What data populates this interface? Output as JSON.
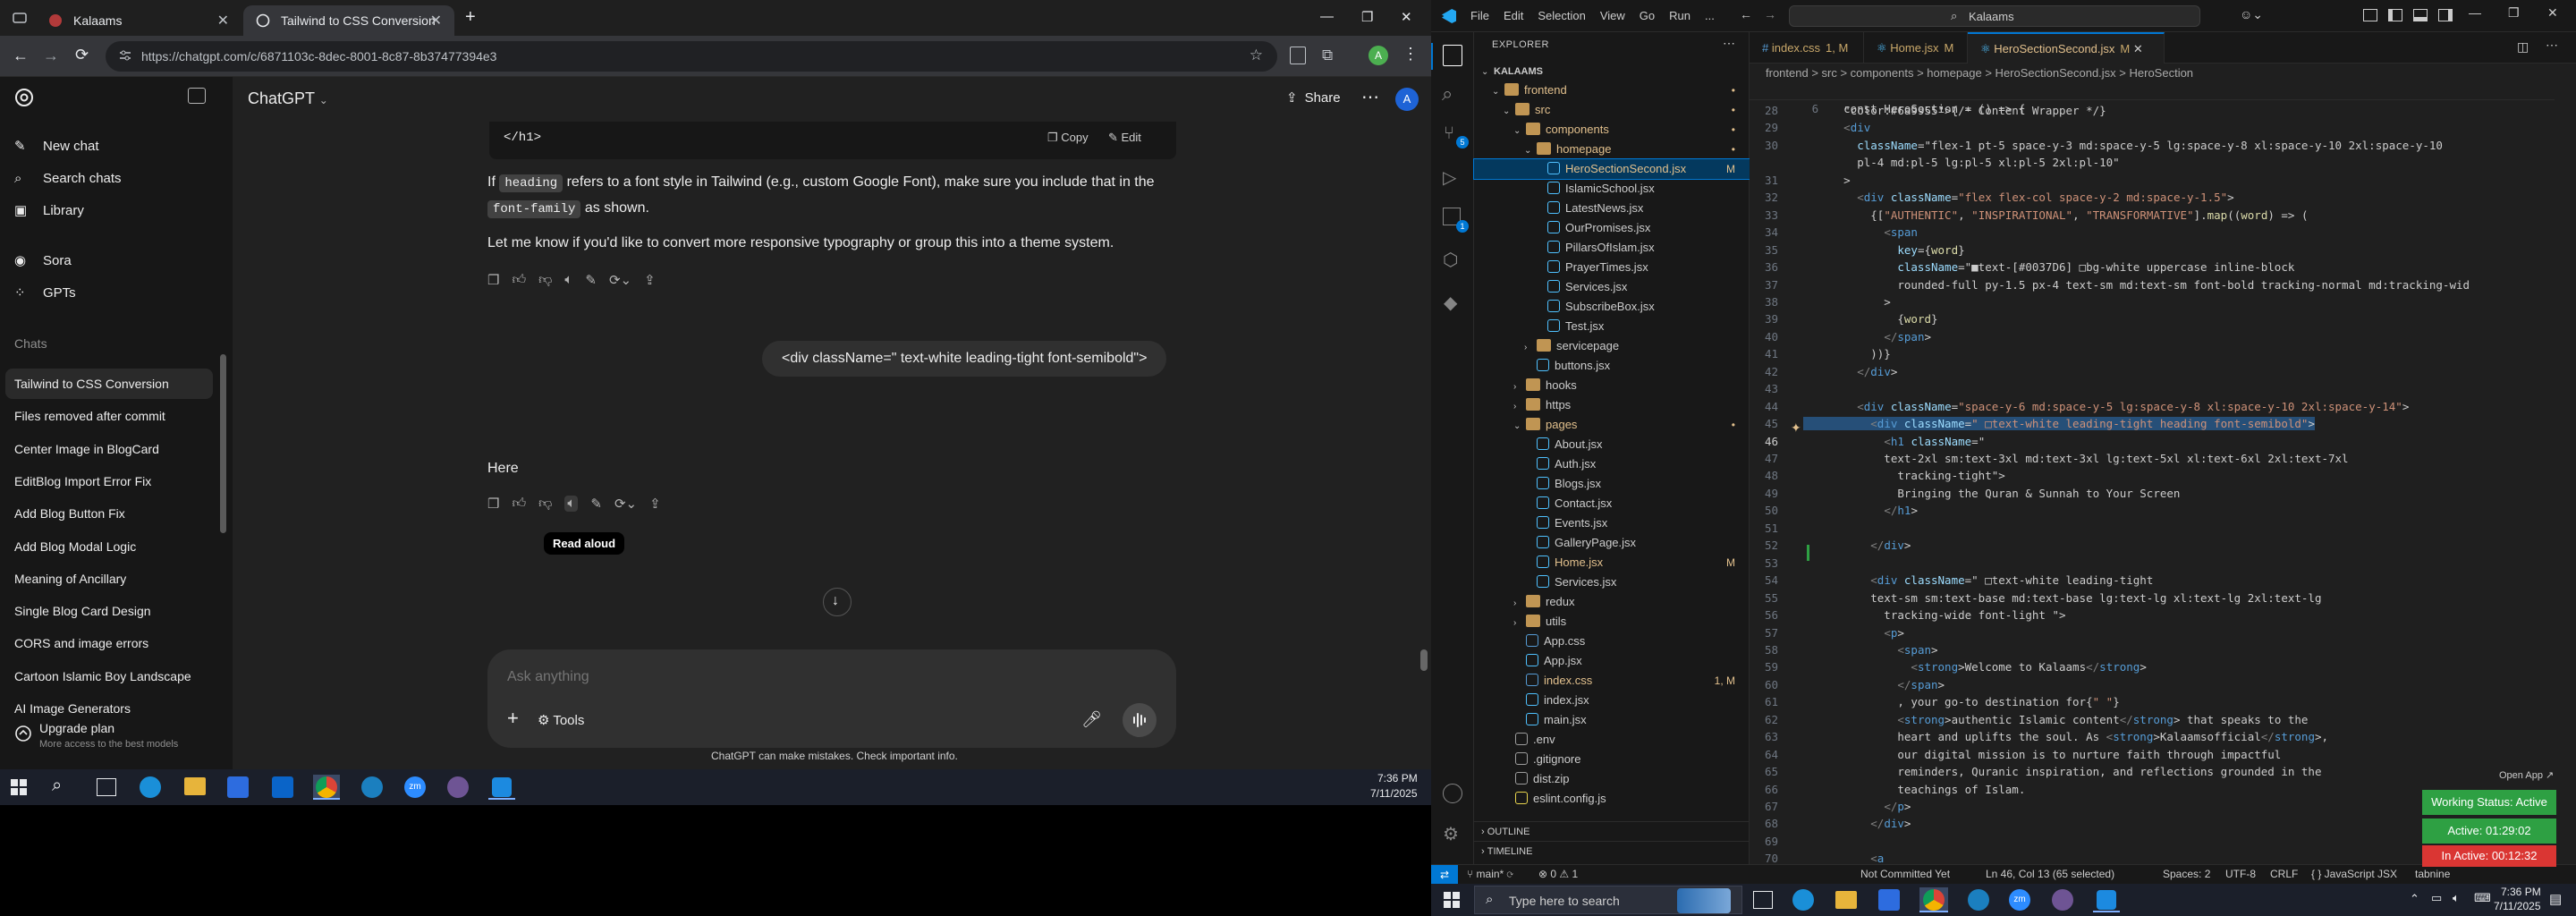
{
  "browser": {
    "tabs": [
      {
        "title": "Kalaams",
        "active": false
      },
      {
        "title": "Tailwind to CSS Conversion",
        "active": true
      }
    ],
    "url": "https://chatgpt.com/c/6871103c-8dec-8001-8c87-8b37477394e3",
    "profile_initial": "A"
  },
  "chatgpt": {
    "sidebar": {
      "new_chat": "New chat",
      "search": "Search chats",
      "library": "Library",
      "sora": "Sora",
      "gpts": "GPTs",
      "chats_heading": "Chats",
      "chats": [
        "Tailwind to CSS Conversion",
        "Files removed after commit",
        "Center Image in BlogCard",
        "EditBlog Import Error Fix",
        "Add Blog Button Fix",
        "Add Blog Modal Logic",
        "Meaning of Ancillary",
        "Single Blog Card Design",
        "CORS and image errors",
        "Cartoon Islamic Boy Landscape",
        "AI Image Generators"
      ],
      "upgrade_title": "Upgrade plan",
      "upgrade_sub": "More access to the best models"
    },
    "header": {
      "model": "ChatGPT",
      "share": "Share",
      "avatar": "A"
    },
    "codeblock": {
      "code": "</h1>",
      "copy": "Copy",
      "edit": "Edit"
    },
    "assistant_msg1": {
      "p1_a": "If ",
      "p1_code1": "heading",
      "p1_b": " refers to a font style in Tailwind (e.g., custom Google Font), make sure you include that in the",
      "p1_code2": "font-family",
      "p1_c": " as shown.",
      "p2": "Let me know if you'd like to convert more responsive typography or group this into a theme system."
    },
    "user_msg": "<div className=\" text-white leading-tight font-semibold\">",
    "assistant_msg2": "Here",
    "tooltip": "Read aloud",
    "composer": {
      "placeholder": "Ask anything",
      "tools": "Tools"
    },
    "disclaimer": "ChatGPT can make mistakes. Check important info."
  },
  "taskbar_left": {
    "time": "7:36 PM",
    "date": "7/11/2025"
  },
  "vscode": {
    "title_search": "Kalaams",
    "menu": [
      "File",
      "Edit",
      "Selection",
      "View",
      "Go",
      "Run",
      "..."
    ],
    "explorer_title": "EXPLORER",
    "tree": [
      {
        "label": "KALAAMS",
        "depth": 0,
        "kind": "root",
        "chev": "v"
      },
      {
        "label": "frontend",
        "depth": 1,
        "kind": "folder",
        "chev": "v",
        "badge": "•",
        "color": "#e2c08d"
      },
      {
        "label": "src",
        "depth": 2,
        "kind": "folder",
        "chev": "v",
        "badge": "•",
        "color": "#e2c08d"
      },
      {
        "label": "components",
        "depth": 3,
        "kind": "folder",
        "chev": "v",
        "badge": "•",
        "color": "#e2c08d"
      },
      {
        "label": "homepage",
        "depth": 4,
        "kind": "folder",
        "chev": "v",
        "badge": "•",
        "color": "#e2c08d"
      },
      {
        "label": "HeroSectionSecond.jsx",
        "depth": 5,
        "kind": "jsx",
        "badge": "M",
        "color": "#e2c08d",
        "selected": true
      },
      {
        "label": "IslamicSchool.jsx",
        "depth": 5,
        "kind": "jsx"
      },
      {
        "label": "LatestNews.jsx",
        "depth": 5,
        "kind": "jsx"
      },
      {
        "label": "OurPromises.jsx",
        "depth": 5,
        "kind": "jsx"
      },
      {
        "label": "PillarsOfIslam.jsx",
        "depth": 5,
        "kind": "jsx"
      },
      {
        "label": "PrayerTimes.jsx",
        "depth": 5,
        "kind": "jsx"
      },
      {
        "label": "Services.jsx",
        "depth": 5,
        "kind": "jsx"
      },
      {
        "label": "SubscribeBox.jsx",
        "depth": 5,
        "kind": "jsx"
      },
      {
        "label": "Test.jsx",
        "depth": 5,
        "kind": "jsx"
      },
      {
        "label": "servicepage",
        "depth": 4,
        "kind": "folder",
        "chev": ">"
      },
      {
        "label": "buttons.jsx",
        "depth": 4,
        "kind": "jsx"
      },
      {
        "label": "hooks",
        "depth": 3,
        "kind": "folder",
        "chev": ">"
      },
      {
        "label": "https",
        "depth": 3,
        "kind": "folder",
        "chev": ">"
      },
      {
        "label": "pages",
        "depth": 3,
        "kind": "folder",
        "chev": "v",
        "badge": "•",
        "color": "#e2c08d"
      },
      {
        "label": "About.jsx",
        "depth": 4,
        "kind": "jsx"
      },
      {
        "label": "Auth.jsx",
        "depth": 4,
        "kind": "jsx"
      },
      {
        "label": "Blogs.jsx",
        "depth": 4,
        "kind": "jsx"
      },
      {
        "label": "Contact.jsx",
        "depth": 4,
        "kind": "jsx"
      },
      {
        "label": "Events.jsx",
        "depth": 4,
        "kind": "jsx"
      },
      {
        "label": "GalleryPage.jsx",
        "depth": 4,
        "kind": "jsx"
      },
      {
        "label": "Home.jsx",
        "depth": 4,
        "kind": "jsx",
        "badge": "M",
        "color": "#e2c08d"
      },
      {
        "label": "Services.jsx",
        "depth": 4,
        "kind": "jsx"
      },
      {
        "label": "redux",
        "depth": 3,
        "kind": "folder",
        "chev": ">"
      },
      {
        "label": "utils",
        "depth": 3,
        "kind": "folder",
        "chev": ">"
      },
      {
        "label": "App.css",
        "depth": 3,
        "kind": "css"
      },
      {
        "label": "App.jsx",
        "depth": 3,
        "kind": "jsx"
      },
      {
        "label": "index.css",
        "depth": 3,
        "kind": "css",
        "badge": "1, M",
        "color": "#e2c08d"
      },
      {
        "label": "index.jsx",
        "depth": 3,
        "kind": "jsx"
      },
      {
        "label": "main.jsx",
        "depth": 3,
        "kind": "jsx"
      },
      {
        "label": ".env",
        "depth": 2,
        "kind": "file"
      },
      {
        "label": ".gitignore",
        "depth": 2,
        "kind": "file"
      },
      {
        "label": "dist.zip",
        "depth": 2,
        "kind": "file"
      },
      {
        "label": "eslint.config.js",
        "depth": 2,
        "kind": "js"
      }
    ],
    "outline": "OUTLINE",
    "timeline": "TIMELINE",
    "tabs": [
      {
        "label": "index.css",
        "badge": "1, M",
        "active": false
      },
      {
        "label": "Home.jsx",
        "badge": "M",
        "active": false
      },
      {
        "label": "HeroSectionSecond.jsx",
        "badge": "M",
        "active": true
      }
    ],
    "breadcrumb": "frontend > src > components > homepage > HeroSectionSecond.jsx > HeroSection",
    "sticky": "const HeroSection = () => {",
    "sticky_ln": "6",
    "current_line": "46",
    "code": [
      {
        "n": "28",
        "t": "      {/* Content Wrapper */}"
      },
      {
        "n": "29",
        "t": "      <div"
      },
      {
        "n": "30",
        "t": "        className=\"flex-1 pt-5 space-y-3 md:space-y-5 lg:space-y-8 xl:space-y-10 2xl:space-y-10"
      },
      {
        "n": "",
        "t": "        pl-4 md:pl-5 lg:pl-5 xl:pl-5 2xl:pl-10\""
      },
      {
        "n": "31",
        "t": "      >"
      },
      {
        "n": "32",
        "t": "        <div className=\"flex flex-col space-y-2 md:space-y-1.5\">"
      },
      {
        "n": "33",
        "t": "          {[\"AUTHENTIC\", \"INSPIRATIONAL\", \"TRANSFORMATIVE\"].map((word) => ("
      },
      {
        "n": "34",
        "t": "            <span"
      },
      {
        "n": "35",
        "t": "              key={word}"
      },
      {
        "n": "36",
        "t": "              className=\"■text-[#0037D6] □bg-white uppercase inline-block"
      },
      {
        "n": "37",
        "t": "              rounded-full py-1.5 px-4 text-sm md:text-sm font-bold tracking-normal md:tracking-wid"
      },
      {
        "n": "38",
        "t": "            >"
      },
      {
        "n": "39",
        "t": "              {word}"
      },
      {
        "n": "40",
        "t": "            </span>"
      },
      {
        "n": "41",
        "t": "          ))}"
      },
      {
        "n": "42",
        "t": "        </div>"
      },
      {
        "n": "43",
        "t": ""
      },
      {
        "n": "44",
        "t": "        <div className=\"space-y-6 md:space-y-5 lg:space-y-8 xl:space-y-10 2xl:space-y-14\">"
      },
      {
        "n": "45",
        "t": "          <div className=\" □text-white leading-tight heading font-semibold\">"
      },
      {
        "n": "46",
        "t": "            <h1 className=\""
      },
      {
        "n": "47",
        "t": "            text-2xl sm:text-3xl md:text-3xl lg:text-5xl xl:text-6xl 2xl:text-7xl"
      },
      {
        "n": "48",
        "t": "              tracking-tight\">"
      },
      {
        "n": "49",
        "t": "              Bringing the Quran & Sunnah to Your Screen"
      },
      {
        "n": "50",
        "t": "            </h1>"
      },
      {
        "n": "51",
        "t": ""
      },
      {
        "n": "52",
        "t": "          </div>"
      },
      {
        "n": "53",
        "t": ""
      },
      {
        "n": "54",
        "t": "          <div className=\" □text-white leading-tight"
      },
      {
        "n": "55",
        "t": "          text-sm sm:text-base md:text-base lg:text-lg xl:text-lg 2xl:text-lg"
      },
      {
        "n": "56",
        "t": "            tracking-wide font-light \">"
      },
      {
        "n": "57",
        "t": "            <p>"
      },
      {
        "n": "58",
        "t": "              <span>"
      },
      {
        "n": "59",
        "t": "                <strong>Welcome to Kalaams</strong>"
      },
      {
        "n": "60",
        "t": "              </span>"
      },
      {
        "n": "61",
        "t": "              , your go-to destination for{\" \"}"
      },
      {
        "n": "62",
        "t": "              <strong>authentic Islamic content</strong> that speaks to the"
      },
      {
        "n": "63",
        "t": "              heart and uplifts the soul. As <strong>Kalaamsofficial</strong>,"
      },
      {
        "n": "64",
        "t": "              our digital mission is to nurture faith through impactful"
      },
      {
        "n": "65",
        "t": "              reminders, Quranic inspiration, and reflections grounded in the"
      },
      {
        "n": "66",
        "t": "              teachings of Islam."
      },
      {
        "n": "67",
        "t": "            </p>"
      },
      {
        "n": "68",
        "t": "          </div>"
      },
      {
        "n": "69",
        "t": ""
      },
      {
        "n": "70",
        "t": "          <a"
      },
      {
        "n": "71",
        "t": ""
      }
    ],
    "overlays": {
      "open_app": "Open App ↗",
      "working": "Working Status: Active",
      "active_time": "Active: 01:29:02",
      "inactive_time": "In Active: 00:12:32"
    },
    "status": {
      "branch": "main*",
      "errors": "⊗ 0 ⚠ 1",
      "left2": "Not Committed Yet",
      "pos": "Ln 46, Col 13 (65 selected)",
      "spaces": "Spaces: 2",
      "encoding": "UTF-8",
      "eol": "CRLF",
      "lang": "{ } JavaScript JSX",
      "ext": "tabnine"
    }
  },
  "taskbar_right": {
    "search_placeholder": "Type here to search",
    "time": "7:36 PM",
    "date": "7/11/2025"
  },
  "colors": {
    "vscode_accent": "#0078d4",
    "working_green": "#2ea043",
    "inactive_red": "#da3633"
  }
}
